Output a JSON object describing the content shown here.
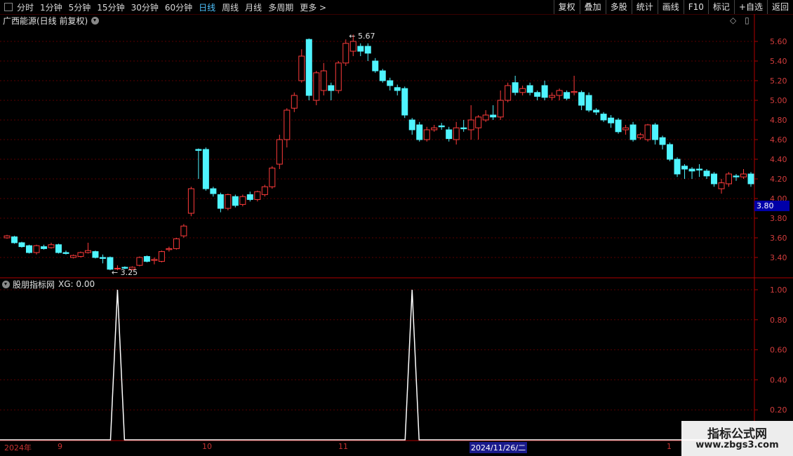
{
  "toolbar": {
    "periods": [
      "分时",
      "1分钟",
      "5分钟",
      "15分钟",
      "30分钟",
      "60分钟",
      "日线",
      "周线",
      "月线",
      "多周期",
      "更多 >"
    ],
    "active_period": "日线",
    "actions": [
      "复权",
      "叠加",
      "多股",
      "统计",
      "画线",
      "F10",
      "标记",
      "+自选",
      "返回"
    ]
  },
  "main_chart": {
    "title": "广西能源(日线 前复权)",
    "current_price_tag": "3.80",
    "high_label": "5.67",
    "low_label": "3.25",
    "y_ticks": [
      "5.60",
      "5.40",
      "5.20",
      "5.00",
      "4.80",
      "4.60",
      "4.40",
      "4.20",
      "4.00",
      "3.80",
      "3.60",
      "3.40"
    ],
    "colors": {
      "up": "#ff3b3b",
      "down": "#4ff4ff",
      "grid": "#5a0000",
      "axis": "#b00000"
    }
  },
  "indicator": {
    "title": "股朋指标网",
    "series_label": "XG: 0.00",
    "y_ticks": [
      "1.00",
      "0.80",
      "0.60",
      "0.40",
      "0.20"
    ]
  },
  "date_axis": {
    "labels": [
      "2024年",
      "9",
      "10",
      "11",
      "1"
    ],
    "cursor_date": "2024/11/26/二"
  },
  "watermark": {
    "line1": "指标公式网",
    "line2": "www.zbgs3.com"
  },
  "chart_data": {
    "type": "candlestick",
    "y_range": [
      3.2,
      5.75
    ],
    "candles": [
      [
        3.6,
        3.62,
        3.63,
        3.59
      ],
      [
        3.61,
        3.55,
        3.62,
        3.54
      ],
      [
        3.55,
        3.51,
        3.56,
        3.5
      ],
      [
        3.52,
        3.45,
        3.53,
        3.44
      ],
      [
        3.45,
        3.52,
        3.53,
        3.43
      ],
      [
        3.51,
        3.49,
        3.53,
        3.48
      ],
      [
        3.5,
        3.53,
        3.55,
        3.49
      ],
      [
        3.53,
        3.45,
        3.54,
        3.44
      ],
      [
        3.45,
        3.44,
        3.47,
        3.43
      ],
      [
        3.4,
        3.42,
        3.43,
        3.39
      ],
      [
        3.41,
        3.45,
        3.46,
        3.4
      ],
      [
        3.45,
        3.47,
        3.55,
        3.44
      ],
      [
        3.46,
        3.4,
        3.47,
        3.39
      ],
      [
        3.4,
        3.39,
        3.43,
        3.34
      ],
      [
        3.4,
        3.28,
        3.41,
        3.27
      ],
      [
        3.29,
        3.29,
        3.32,
        3.27
      ],
      [
        3.3,
        3.29,
        3.31,
        3.28
      ],
      [
        3.28,
        3.3,
        3.31,
        3.27
      ],
      [
        3.32,
        3.4,
        3.41,
        3.31
      ],
      [
        3.41,
        3.36,
        3.42,
        3.35
      ],
      [
        3.37,
        3.38,
        3.4,
        3.33
      ],
      [
        3.36,
        3.46,
        3.47,
        3.35
      ],
      [
        3.48,
        3.49,
        3.51,
        3.46
      ],
      [
        3.49,
        3.59,
        3.6,
        3.48
      ],
      [
        3.62,
        3.72,
        3.74,
        3.6
      ],
      [
        3.85,
        4.1,
        4.12,
        3.82
      ],
      [
        4.5,
        4.49,
        4.51,
        4.2
      ],
      [
        4.5,
        4.1,
        4.52,
        4.08
      ],
      [
        4.1,
        4.05,
        4.12,
        4.02
      ],
      [
        4.04,
        3.9,
        4.06,
        3.86
      ],
      [
        3.9,
        4.04,
        4.05,
        3.88
      ],
      [
        4.02,
        3.93,
        4.04,
        3.91
      ],
      [
        3.94,
        4.02,
        4.04,
        3.92
      ],
      [
        4.04,
        3.99,
        4.07,
        3.97
      ],
      [
        3.99,
        4.07,
        4.08,
        3.97
      ],
      [
        4.04,
        4.12,
        4.14,
        4.02
      ],
      [
        4.12,
        4.31,
        4.33,
        4.1
      ],
      [
        4.35,
        4.6,
        4.65,
        4.3
      ],
      [
        4.6,
        4.9,
        4.92,
        4.52
      ],
      [
        4.92,
        5.05,
        5.08,
        4.88
      ],
      [
        5.2,
        5.45,
        5.52,
        5.18
      ],
      [
        5.62,
        5.05,
        5.63,
        5.0
      ],
      [
        5.0,
        5.28,
        5.3,
        4.95
      ],
      [
        5.1,
        5.3,
        5.38,
        5.05
      ],
      [
        5.15,
        5.1,
        5.18,
        5.0
      ],
      [
        5.1,
        5.38,
        5.4,
        5.07
      ],
      [
        5.38,
        5.58,
        5.62,
        5.35
      ],
      [
        5.5,
        5.6,
        5.67,
        5.45
      ],
      [
        5.55,
        5.5,
        5.58,
        5.45
      ],
      [
        5.55,
        5.48,
        5.58,
        5.4
      ],
      [
        5.4,
        5.3,
        5.43,
        5.28
      ],
      [
        5.3,
        5.2,
        5.32,
        5.18
      ],
      [
        5.2,
        5.15,
        5.23,
        5.1
      ],
      [
        5.13,
        5.1,
        5.16,
        5.05
      ],
      [
        5.12,
        4.85,
        5.14,
        4.82
      ],
      [
        4.8,
        4.7,
        4.82,
        4.65
      ],
      [
        4.75,
        4.6,
        4.78,
        4.58
      ],
      [
        4.6,
        4.7,
        4.73,
        4.58
      ],
      [
        4.7,
        4.72,
        4.75,
        4.68
      ],
      [
        4.74,
        4.73,
        4.77,
        4.7
      ],
      [
        4.7,
        4.61,
        4.73,
        4.58
      ],
      [
        4.6,
        4.72,
        4.78,
        4.55
      ],
      [
        4.72,
        4.71,
        4.8,
        4.68
      ],
      [
        4.7,
        4.8,
        4.95,
        4.6
      ],
      [
        4.72,
        4.83,
        4.85,
        4.6
      ],
      [
        4.8,
        4.85,
        4.9,
        4.78
      ],
      [
        4.85,
        4.83,
        4.95,
        4.8
      ],
      [
        4.83,
        5.0,
        5.1,
        4.8
      ],
      [
        5.0,
        5.15,
        5.18,
        4.98
      ],
      [
        5.18,
        5.08,
        5.25,
        5.05
      ],
      [
        5.08,
        5.12,
        5.15,
        5.05
      ],
      [
        5.15,
        5.08,
        5.18,
        5.05
      ],
      [
        5.08,
        5.04,
        5.1,
        5.0
      ],
      [
        5.15,
        5.03,
        5.2,
        5.0
      ],
      [
        5.03,
        5.05,
        5.08,
        5.0
      ],
      [
        5.05,
        5.1,
        5.12,
        5.0
      ],
      [
        5.08,
        5.02,
        5.1,
        5.0
      ],
      [
        5.08,
        5.09,
        5.25,
        5.05
      ],
      [
        5.08,
        4.95,
        5.1,
        4.9
      ],
      [
        5.05,
        4.9,
        5.08,
        4.88
      ],
      [
        4.9,
        4.88,
        4.92,
        4.85
      ],
      [
        4.86,
        4.8,
        4.88,
        4.78
      ],
      [
        4.82,
        4.77,
        4.85,
        4.72
      ],
      [
        4.8,
        4.68,
        4.82,
        4.66
      ],
      [
        4.7,
        4.72,
        4.75,
        4.65
      ],
      [
        4.75,
        4.6,
        4.78,
        4.58
      ],
      [
        4.62,
        4.65,
        4.67,
        4.6
      ],
      [
        4.6,
        4.75,
        4.76,
        4.58
      ],
      [
        4.75,
        4.6,
        4.77,
        4.55
      ],
      [
        4.62,
        4.55,
        4.64,
        4.5
      ],
      [
        4.55,
        4.4,
        4.57,
        4.38
      ],
      [
        4.4,
        4.25,
        4.42,
        4.22
      ],
      [
        4.33,
        4.3,
        4.35,
        4.2
      ],
      [
        4.3,
        4.28,
        4.32,
        4.2
      ],
      [
        4.3,
        4.29,
        4.35,
        4.22
      ],
      [
        4.28,
        4.23,
        4.3,
        4.2
      ],
      [
        4.25,
        4.15,
        4.27,
        4.12
      ],
      [
        4.1,
        4.16,
        4.2,
        4.05
      ],
      [
        4.15,
        4.25,
        4.27,
        4.12
      ],
      [
        4.23,
        4.22,
        4.25,
        4.18
      ],
      [
        4.22,
        4.25,
        4.3,
        4.2
      ],
      [
        4.25,
        4.15,
        4.27,
        4.12
      ]
    ],
    "indicator": {
      "name": "XG",
      "signal_indices": [
        15,
        55
      ]
    }
  }
}
